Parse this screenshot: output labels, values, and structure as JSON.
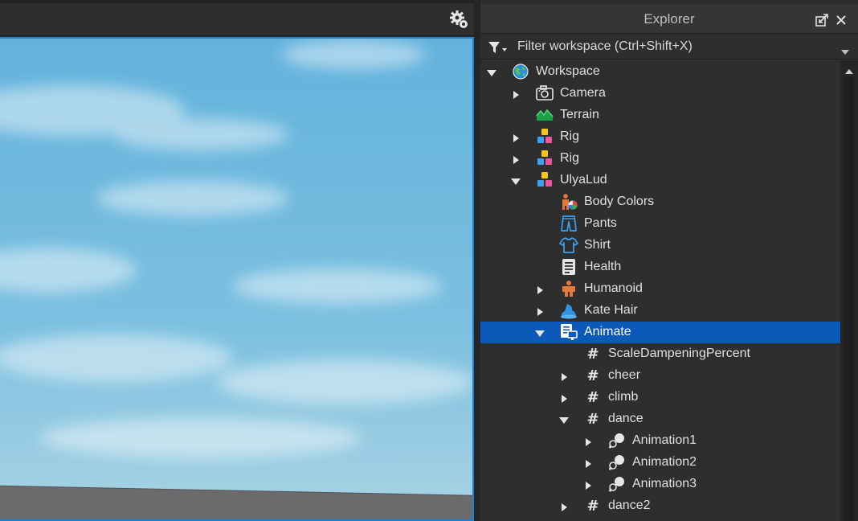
{
  "viewport": {
    "settings_icon": "gear-icon"
  },
  "explorer": {
    "title": "Explorer",
    "dock_icon": "undock-icon",
    "close_icon": "close-icon",
    "filter": {
      "placeholder": "Filter workspace (Ctrl+Shift+X)",
      "value": "",
      "icon": "filter-icon",
      "dropdown_icon": "chevron-down-icon"
    },
    "tree": [
      {
        "label": "Workspace",
        "depth": 0,
        "expander": "expanded",
        "icon": "workspace-icon",
        "selected": false
      },
      {
        "label": "Camera",
        "depth": 1,
        "expander": "collapsed",
        "icon": "camera-icon",
        "selected": false
      },
      {
        "label": "Terrain",
        "depth": 1,
        "expander": "none",
        "icon": "terrain-icon",
        "selected": false
      },
      {
        "label": "Rig",
        "depth": 1,
        "expander": "collapsed",
        "icon": "model-icon",
        "selected": false
      },
      {
        "label": "Rig",
        "depth": 1,
        "expander": "collapsed",
        "icon": "model-icon",
        "selected": false
      },
      {
        "label": "UlyaLud",
        "depth": 1,
        "expander": "expanded",
        "icon": "model-icon",
        "selected": false
      },
      {
        "label": "Body Colors",
        "depth": 2,
        "expander": "none",
        "icon": "body-colors-icon",
        "selected": false
      },
      {
        "label": "Pants",
        "depth": 2,
        "expander": "none",
        "icon": "pants-icon",
        "selected": false
      },
      {
        "label": "Shirt",
        "depth": 2,
        "expander": "none",
        "icon": "shirt-icon",
        "selected": false
      },
      {
        "label": "Health",
        "depth": 2,
        "expander": "none",
        "icon": "script-icon",
        "selected": false
      },
      {
        "label": "Humanoid",
        "depth": 2,
        "expander": "collapsed",
        "icon": "humanoid-icon",
        "selected": false
      },
      {
        "label": "Kate Hair",
        "depth": 2,
        "expander": "collapsed",
        "icon": "accessory-icon",
        "selected": false
      },
      {
        "label": "Animate",
        "depth": 2,
        "expander": "expanded",
        "icon": "local-script-icon",
        "selected": true
      },
      {
        "label": "ScaleDampeningPercent",
        "depth": 3,
        "expander": "none",
        "icon": "value-icon",
        "selected": false
      },
      {
        "label": "cheer",
        "depth": 3,
        "expander": "collapsed",
        "icon": "value-icon",
        "selected": false
      },
      {
        "label": "climb",
        "depth": 3,
        "expander": "collapsed",
        "icon": "value-icon",
        "selected": false
      },
      {
        "label": "dance",
        "depth": 3,
        "expander": "expanded",
        "icon": "value-icon",
        "selected": false
      },
      {
        "label": "Animation1",
        "depth": 4,
        "expander": "collapsed",
        "icon": "animation-icon",
        "selected": false
      },
      {
        "label": "Animation2",
        "depth": 4,
        "expander": "collapsed",
        "icon": "animation-icon",
        "selected": false
      },
      {
        "label": "Animation3",
        "depth": 4,
        "expander": "collapsed",
        "icon": "animation-icon",
        "selected": false
      },
      {
        "label": "dance2",
        "depth": 3,
        "expander": "collapsed",
        "icon": "value-icon",
        "selected": false
      }
    ]
  },
  "scrollbar": {
    "up_icon": "scroll-up-icon"
  },
  "colors": {
    "selection": "#0b5aba",
    "viewport_border": "#1a82d8",
    "panel_bg": "#2e2e2e",
    "text": "#e0e0e0"
  }
}
